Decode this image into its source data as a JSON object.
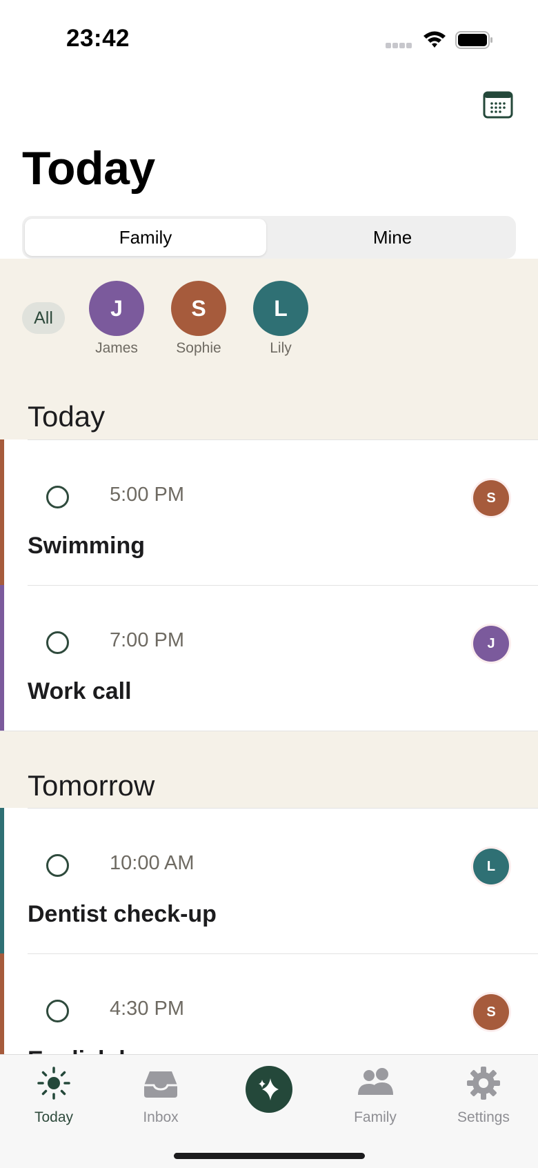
{
  "status_bar": {
    "time": "23:42"
  },
  "header": {
    "title": "Today"
  },
  "segments": {
    "family": "Family",
    "mine": "Mine"
  },
  "filters": {
    "all": "All",
    "members": [
      {
        "initial": "J",
        "name": "James",
        "color": "#7b5a9c"
      },
      {
        "initial": "S",
        "name": "Sophie",
        "color": "#a65b3c"
      },
      {
        "initial": "L",
        "name": "Lily",
        "color": "#2f7074"
      }
    ]
  },
  "sections": [
    {
      "title": "Today",
      "events": [
        {
          "time": "5:00 PM",
          "title": "Swimming",
          "initial": "S",
          "color": "#a65b3c"
        },
        {
          "time": "7:00 PM",
          "title": "Work call",
          "initial": "J",
          "color": "#7b5a9c"
        }
      ]
    },
    {
      "title": "Tomorrow",
      "events": [
        {
          "time": "10:00 AM",
          "title": "Dentist check-up",
          "initial": "L",
          "color": "#2f7074"
        },
        {
          "time": "4:30 PM",
          "title": "English l",
          "initial": "S",
          "color": "#a65b3c"
        }
      ]
    }
  ],
  "tab_bar": {
    "today": "Today",
    "inbox": "Inbox",
    "family": "Family",
    "settings": "Settings"
  },
  "colors": {
    "accent": "#24483a",
    "cream": "#f5f1e8"
  }
}
